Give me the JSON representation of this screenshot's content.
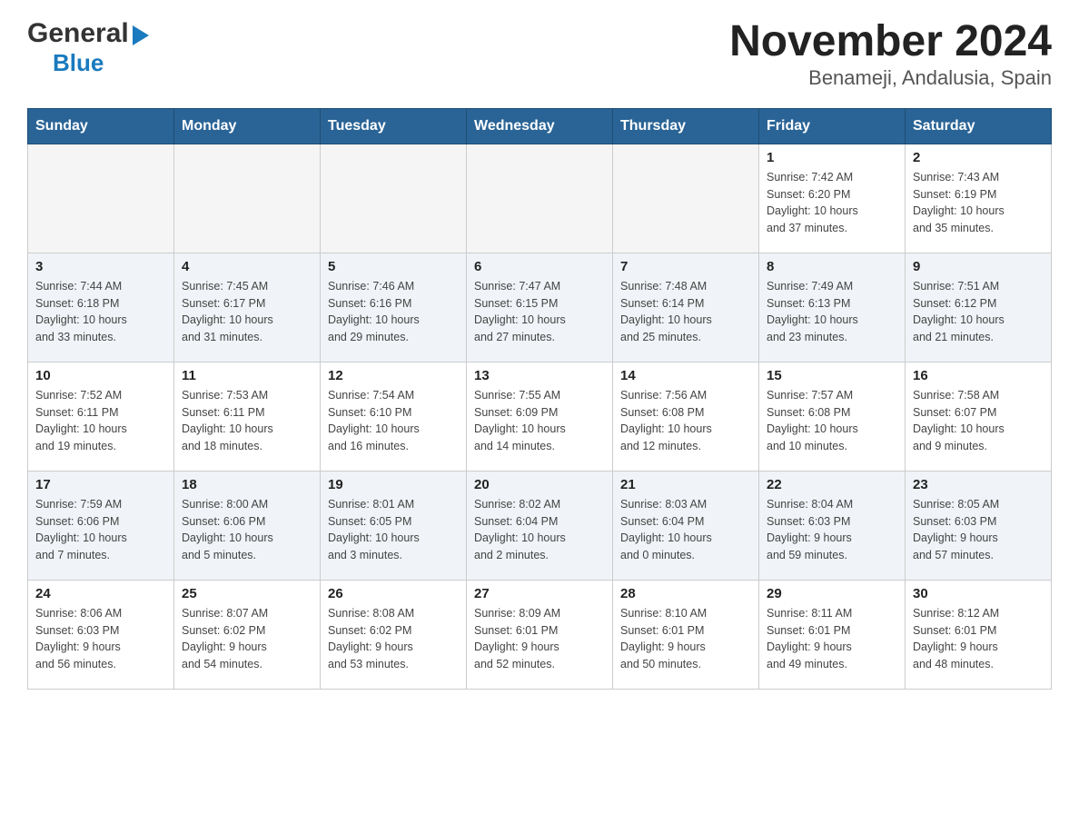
{
  "header": {
    "logo_general": "General",
    "logo_blue": "Blue",
    "title": "November 2024",
    "subtitle": "Benameji, Andalusia, Spain"
  },
  "days_of_week": [
    "Sunday",
    "Monday",
    "Tuesday",
    "Wednesday",
    "Thursday",
    "Friday",
    "Saturday"
  ],
  "weeks": [
    [
      {
        "day": "",
        "info": ""
      },
      {
        "day": "",
        "info": ""
      },
      {
        "day": "",
        "info": ""
      },
      {
        "day": "",
        "info": ""
      },
      {
        "day": "",
        "info": ""
      },
      {
        "day": "1",
        "info": "Sunrise: 7:42 AM\nSunset: 6:20 PM\nDaylight: 10 hours\nand 37 minutes."
      },
      {
        "day": "2",
        "info": "Sunrise: 7:43 AM\nSunset: 6:19 PM\nDaylight: 10 hours\nand 35 minutes."
      }
    ],
    [
      {
        "day": "3",
        "info": "Sunrise: 7:44 AM\nSunset: 6:18 PM\nDaylight: 10 hours\nand 33 minutes."
      },
      {
        "day": "4",
        "info": "Sunrise: 7:45 AM\nSunset: 6:17 PM\nDaylight: 10 hours\nand 31 minutes."
      },
      {
        "day": "5",
        "info": "Sunrise: 7:46 AM\nSunset: 6:16 PM\nDaylight: 10 hours\nand 29 minutes."
      },
      {
        "day": "6",
        "info": "Sunrise: 7:47 AM\nSunset: 6:15 PM\nDaylight: 10 hours\nand 27 minutes."
      },
      {
        "day": "7",
        "info": "Sunrise: 7:48 AM\nSunset: 6:14 PM\nDaylight: 10 hours\nand 25 minutes."
      },
      {
        "day": "8",
        "info": "Sunrise: 7:49 AM\nSunset: 6:13 PM\nDaylight: 10 hours\nand 23 minutes."
      },
      {
        "day": "9",
        "info": "Sunrise: 7:51 AM\nSunset: 6:12 PM\nDaylight: 10 hours\nand 21 minutes."
      }
    ],
    [
      {
        "day": "10",
        "info": "Sunrise: 7:52 AM\nSunset: 6:11 PM\nDaylight: 10 hours\nand 19 minutes."
      },
      {
        "day": "11",
        "info": "Sunrise: 7:53 AM\nSunset: 6:11 PM\nDaylight: 10 hours\nand 18 minutes."
      },
      {
        "day": "12",
        "info": "Sunrise: 7:54 AM\nSunset: 6:10 PM\nDaylight: 10 hours\nand 16 minutes."
      },
      {
        "day": "13",
        "info": "Sunrise: 7:55 AM\nSunset: 6:09 PM\nDaylight: 10 hours\nand 14 minutes."
      },
      {
        "day": "14",
        "info": "Sunrise: 7:56 AM\nSunset: 6:08 PM\nDaylight: 10 hours\nand 12 minutes."
      },
      {
        "day": "15",
        "info": "Sunrise: 7:57 AM\nSunset: 6:08 PM\nDaylight: 10 hours\nand 10 minutes."
      },
      {
        "day": "16",
        "info": "Sunrise: 7:58 AM\nSunset: 6:07 PM\nDaylight: 10 hours\nand 9 minutes."
      }
    ],
    [
      {
        "day": "17",
        "info": "Sunrise: 7:59 AM\nSunset: 6:06 PM\nDaylight: 10 hours\nand 7 minutes."
      },
      {
        "day": "18",
        "info": "Sunrise: 8:00 AM\nSunset: 6:06 PM\nDaylight: 10 hours\nand 5 minutes."
      },
      {
        "day": "19",
        "info": "Sunrise: 8:01 AM\nSunset: 6:05 PM\nDaylight: 10 hours\nand 3 minutes."
      },
      {
        "day": "20",
        "info": "Sunrise: 8:02 AM\nSunset: 6:04 PM\nDaylight: 10 hours\nand 2 minutes."
      },
      {
        "day": "21",
        "info": "Sunrise: 8:03 AM\nSunset: 6:04 PM\nDaylight: 10 hours\nand 0 minutes."
      },
      {
        "day": "22",
        "info": "Sunrise: 8:04 AM\nSunset: 6:03 PM\nDaylight: 9 hours\nand 59 minutes."
      },
      {
        "day": "23",
        "info": "Sunrise: 8:05 AM\nSunset: 6:03 PM\nDaylight: 9 hours\nand 57 minutes."
      }
    ],
    [
      {
        "day": "24",
        "info": "Sunrise: 8:06 AM\nSunset: 6:03 PM\nDaylight: 9 hours\nand 56 minutes."
      },
      {
        "day": "25",
        "info": "Sunrise: 8:07 AM\nSunset: 6:02 PM\nDaylight: 9 hours\nand 54 minutes."
      },
      {
        "day": "26",
        "info": "Sunrise: 8:08 AM\nSunset: 6:02 PM\nDaylight: 9 hours\nand 53 minutes."
      },
      {
        "day": "27",
        "info": "Sunrise: 8:09 AM\nSunset: 6:01 PM\nDaylight: 9 hours\nand 52 minutes."
      },
      {
        "day": "28",
        "info": "Sunrise: 8:10 AM\nSunset: 6:01 PM\nDaylight: 9 hours\nand 50 minutes."
      },
      {
        "day": "29",
        "info": "Sunrise: 8:11 AM\nSunset: 6:01 PM\nDaylight: 9 hours\nand 49 minutes."
      },
      {
        "day": "30",
        "info": "Sunrise: 8:12 AM\nSunset: 6:01 PM\nDaylight: 9 hours\nand 48 minutes."
      }
    ]
  ]
}
